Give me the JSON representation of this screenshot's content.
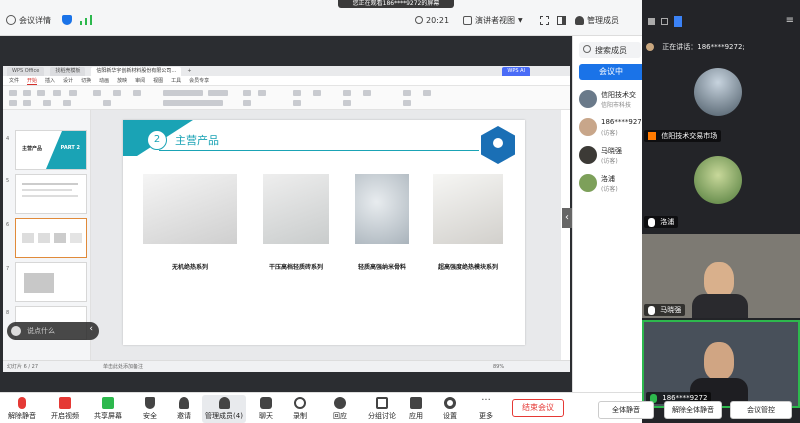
{
  "share_banner": "您正在观看186****9272的屏幕",
  "topbar": {
    "meeting_details": "会议详情",
    "time": "20:21",
    "view_mode": "演讲者视图",
    "manage_members": "管理成员"
  },
  "wps": {
    "tabs": [
      "WPS Office",
      "找稻壳模板",
      "信阳新华宇创新材料股份有限公司…",
      "WPS AI"
    ],
    "menu": [
      "文件",
      "开始",
      "插入",
      "设计",
      "切换",
      "动画",
      "放映",
      "审阅",
      "视图",
      "工具",
      "会员专享"
    ],
    "active_menu": "开始",
    "thumbnail_numbers": [
      "4",
      "5",
      "6",
      "7",
      "8"
    ],
    "thumb_title": "主营产品",
    "thumb_part": "PART 2",
    "status_left": "幻灯片 6 / 27",
    "status_notes": "单击此处添加备注",
    "zoom": "89%"
  },
  "slide": {
    "number": "2",
    "title": "主营产品",
    "products": [
      {
        "label": "无机绝热系列"
      },
      {
        "label": "干压高档轻质砖系列"
      },
      {
        "label": "轻质高强纳米骨料"
      },
      {
        "label": "超高强度绝热模块系列"
      }
    ]
  },
  "overlay": {
    "label": "说点什么"
  },
  "panel": {
    "search_placeholder": "搜索成员",
    "meeting_btn": "会议中",
    "members": [
      {
        "name": "信阳技术交",
        "sub": "信阳市科技"
      },
      {
        "name": "186****927",
        "sub": "(访客)"
      },
      {
        "name": "马晓强",
        "sub": "(访客)"
      },
      {
        "name": "洛浦",
        "sub": "(访客)"
      }
    ]
  },
  "video": {
    "speaking": "正在讲话：186****9272;",
    "tiles": [
      {
        "name": "信阳技术交易市场"
      },
      {
        "name": "洛浦"
      },
      {
        "name": "马晓强"
      },
      {
        "name": "186****9272"
      }
    ]
  },
  "toolbar": {
    "items": [
      "解除静音",
      "开启视频",
      "共享屏幕",
      "安全",
      "邀请",
      "管理成员(4)",
      "聊天",
      "录制",
      "回应",
      "分组讨论",
      "应用",
      "设置",
      "更多"
    ],
    "end_meeting": "结束会议",
    "mute_all": "全体静音",
    "unmute_all": "解除全体静音",
    "meeting_control": "会议管控"
  },
  "colors": {
    "accent": "#1a73e8",
    "end_red": "#e53935",
    "slide_teal": "#1aa3b5",
    "green": "#2db84d"
  }
}
